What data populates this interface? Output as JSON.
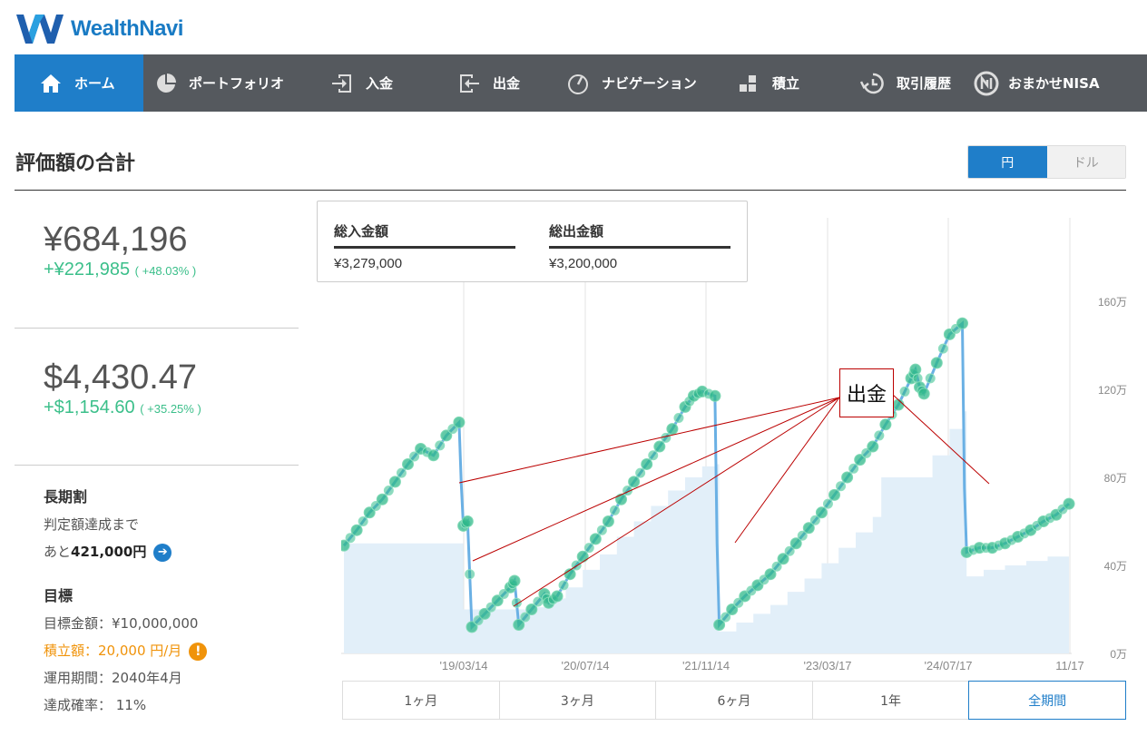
{
  "brand": {
    "name": "WealthNavi"
  },
  "nav": [
    {
      "label": "ホーム",
      "icon": "home-icon",
      "active": true
    },
    {
      "label": "ポートフォリオ",
      "icon": "pie-chart-icon"
    },
    {
      "label": "入金",
      "icon": "deposit-icon"
    },
    {
      "label": "出金",
      "icon": "withdraw-icon"
    },
    {
      "label": "ナビゲーション",
      "icon": "gauge-icon"
    },
    {
      "label": "積立",
      "icon": "blocks-icon"
    },
    {
      "label": "取引履歴",
      "icon": "history-icon"
    },
    {
      "label": "おまかせNISA",
      "icon": "nisa-icon"
    }
  ],
  "page": {
    "title": "評価額の合計"
  },
  "currency": {
    "yen": "円",
    "dollar": "ドル",
    "selected": "円"
  },
  "valuation": {
    "yen_total": "¥684,196",
    "yen_gain": "+¥221,985",
    "yen_pct": "( +48.03% )",
    "usd_total": "$4,430.47",
    "usd_gain": "+$1,154.60",
    "usd_pct": "( +35.25% )"
  },
  "long_term": {
    "heading": "長期割",
    "line1": "判定額達成まで",
    "prefix": "あと",
    "amount": "421,000円"
  },
  "goal": {
    "heading": "目標",
    "target": "目標金額：¥10,000,000",
    "monthly": "積立額：20,000 円/月",
    "period": "運用期間：2040年4月",
    "probability": "達成確率：  11%"
  },
  "summary": {
    "deposit_label": "総入金額",
    "deposit_value": "¥3,279,000",
    "withdraw_label": "総出金額",
    "withdraw_value": "¥3,200,000"
  },
  "annotation": {
    "text": "出金"
  },
  "periods": [
    {
      "label": "1ヶ月"
    },
    {
      "label": "3ヶ月"
    },
    {
      "label": "6ヶ月"
    },
    {
      "label": "1年"
    },
    {
      "label": "全期間",
      "active": true
    }
  ],
  "colors": {
    "accent": "#1f7ec9",
    "gain": "#3bbf8a",
    "nav_bg": "#55595e",
    "area": "#e2eff9",
    "line": "#6ab0e4",
    "dots": "#2fb88a"
  },
  "chart_data": {
    "type": "area",
    "x_ticks": [
      "'19/03/14",
      "'20/07/14",
      "'21/11/14",
      "'23/03/17",
      "'24/07/17",
      "11/17"
    ],
    "y_ticks": [
      "0万",
      "40万",
      "80万",
      "120万",
      "160万"
    ],
    "ylim": [
      0,
      160
    ],
    "y_unit": "万",
    "grid": "vertical",
    "series": [
      {
        "role": "valuation",
        "points": [
          [
            0,
            49
          ],
          [
            3,
            56
          ],
          [
            6,
            64
          ],
          [
            9,
            70
          ],
          [
            12,
            78
          ],
          [
            15,
            86
          ],
          [
            18,
            93
          ],
          [
            21,
            90
          ],
          [
            24,
            99
          ],
          [
            27,
            105
          ],
          [
            27.5,
            77
          ],
          [
            28,
            58
          ],
          [
            29,
            60
          ],
          [
            30,
            12
          ],
          [
            33,
            18
          ],
          [
            36,
            24
          ],
          [
            39,
            30
          ],
          [
            40,
            33
          ],
          [
            41,
            13
          ],
          [
            44,
            20
          ],
          [
            47,
            27
          ],
          [
            48,
            23
          ],
          [
            50,
            26
          ],
          [
            53,
            36
          ],
          [
            56,
            44
          ],
          [
            59,
            52
          ],
          [
            62,
            60
          ],
          [
            65,
            70
          ],
          [
            68,
            78
          ],
          [
            71,
            86
          ],
          [
            74,
            94
          ],
          [
            77,
            102
          ],
          [
            80,
            112
          ],
          [
            82,
            117
          ],
          [
            84,
            119
          ],
          [
            87,
            117
          ],
          [
            87.5,
            50
          ],
          [
            88,
            13
          ],
          [
            91,
            20
          ],
          [
            94,
            26
          ],
          [
            97,
            31
          ],
          [
            100,
            36
          ],
          [
            103,
            43
          ],
          [
            106,
            50
          ],
          [
            109,
            57
          ],
          [
            112,
            64
          ],
          [
            115,
            72
          ],
          [
            118,
            80
          ],
          [
            121,
            88
          ],
          [
            124,
            94
          ],
          [
            127,
            104
          ],
          [
            130,
            113
          ],
          [
            133,
            125
          ],
          [
            134,
            129
          ],
          [
            135,
            121
          ],
          [
            136,
            118
          ],
          [
            139,
            132
          ],
          [
            142,
            145
          ],
          [
            145,
            150
          ],
          [
            145.5,
            75
          ],
          [
            146,
            46
          ],
          [
            149,
            48
          ],
          [
            152,
            48
          ],
          [
            155,
            50
          ],
          [
            158,
            53
          ],
          [
            161,
            56
          ],
          [
            164,
            60
          ],
          [
            167,
            63
          ],
          [
            170,
            68
          ]
        ]
      },
      {
        "role": "principal",
        "points": [
          [
            0,
            50
          ],
          [
            27,
            50
          ],
          [
            28,
            20
          ],
          [
            41,
            20
          ],
          [
            44,
            21
          ],
          [
            48,
            25
          ],
          [
            52,
            30
          ],
          [
            56,
            38
          ],
          [
            60,
            45
          ],
          [
            64,
            53
          ],
          [
            68,
            60
          ],
          [
            72,
            67
          ],
          [
            76,
            74
          ],
          [
            80,
            80
          ],
          [
            84,
            85
          ],
          [
            87,
            86
          ],
          [
            88,
            10
          ],
          [
            92,
            14
          ],
          [
            96,
            18
          ],
          [
            100,
            22
          ],
          [
            104,
            28
          ],
          [
            108,
            34
          ],
          [
            112,
            41
          ],
          [
            116,
            48
          ],
          [
            120,
            55
          ],
          [
            124,
            62
          ],
          [
            126,
            80
          ],
          [
            134,
            80
          ],
          [
            138,
            90
          ],
          [
            142,
            102
          ],
          [
            145,
            110
          ],
          [
            146,
            35
          ],
          [
            150,
            38
          ],
          [
            155,
            40
          ],
          [
            160,
            42
          ],
          [
            165,
            44
          ],
          [
            170,
            46
          ]
        ]
      }
    ]
  }
}
